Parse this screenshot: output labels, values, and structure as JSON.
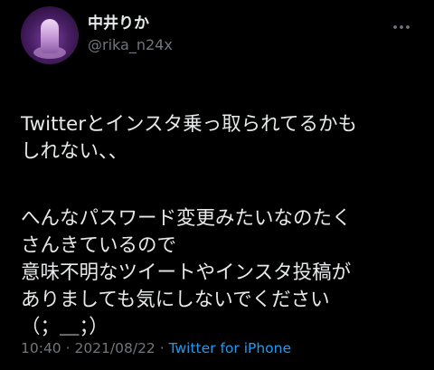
{
  "author": {
    "display_name": "中井りか",
    "handle": "@rika_n24x"
  },
  "icons": {
    "more": "more-horizontal-icon",
    "avatar": "profile-avatar"
  },
  "tweet": {
    "paragraph1": "Twitterとインスタ乗っ取られてるかも\nしれない、、",
    "paragraph2": "へんなパスワード変更みたいなのたく\nさんきているので\n意味不明なツイートやインスタ投稿が\nありましても気にしないでください\n（；＿；）"
  },
  "meta": {
    "time": "10:40",
    "separator1": " · ",
    "date": "2021/08/22",
    "separator2": " · ",
    "source": "Twitter for iPhone"
  },
  "colors": {
    "background": "#000000",
    "text_primary": "#e7e9ea",
    "text_secondary": "#71767b",
    "link": "#1d9bf0"
  }
}
